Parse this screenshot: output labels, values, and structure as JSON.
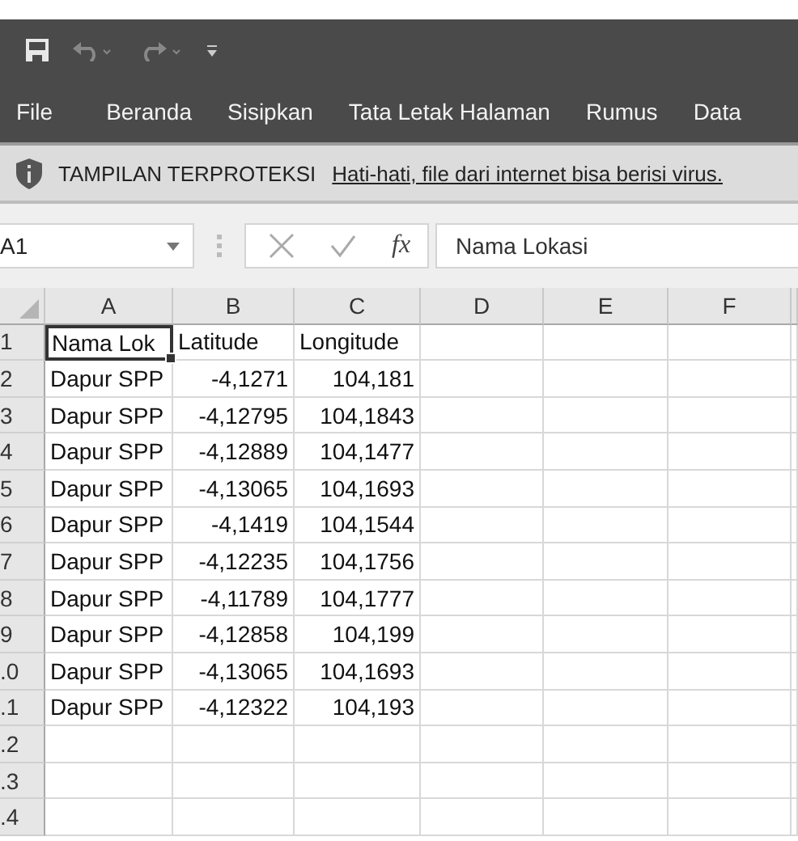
{
  "menu": [
    {
      "label": "File"
    },
    {
      "label": "Beranda"
    },
    {
      "label": "Sisipkan"
    },
    {
      "label": "Tata Letak Halaman"
    },
    {
      "label": "Rumus"
    },
    {
      "label": "Data"
    }
  ],
  "protected_view": {
    "label": "TAMPILAN TERPROTEKSI",
    "message": "Hati-hati, file dari internet bisa berisi virus."
  },
  "formula_bar": {
    "name_box": "A1",
    "function_label": "fx",
    "value": "Nama Lokasi"
  },
  "sheet": {
    "columns": [
      "A",
      "B",
      "C",
      "D",
      "E",
      "F"
    ],
    "rows": [
      {
        "header": "1",
        "cells": [
          {
            "text": "Nama Lok",
            "kind": "text",
            "selected": true
          },
          {
            "text": "Latitude",
            "kind": "text",
            "selected": false
          },
          {
            "text": "Longitude",
            "kind": "text",
            "selected": false
          }
        ]
      },
      {
        "header": "2",
        "cells": [
          {
            "text": "Dapur SPP",
            "kind": "text",
            "selected": false
          },
          {
            "text": "-4,1271",
            "kind": "number",
            "selected": false
          },
          {
            "text": "104,181",
            "kind": "number",
            "selected": false
          }
        ]
      },
      {
        "header": "3",
        "cells": [
          {
            "text": "Dapur SPP",
            "kind": "text",
            "selected": false
          },
          {
            "text": "-4,12795",
            "kind": "number",
            "selected": false
          },
          {
            "text": "104,1843",
            "kind": "number",
            "selected": false
          }
        ]
      },
      {
        "header": "4",
        "cells": [
          {
            "text": "Dapur SPP",
            "kind": "text",
            "selected": false
          },
          {
            "text": "-4,12889",
            "kind": "number",
            "selected": false
          },
          {
            "text": "104,1477",
            "kind": "number",
            "selected": false
          }
        ]
      },
      {
        "header": "5",
        "cells": [
          {
            "text": "Dapur SPP",
            "kind": "text",
            "selected": false
          },
          {
            "text": "-4,13065",
            "kind": "number",
            "selected": false
          },
          {
            "text": "104,1693",
            "kind": "number",
            "selected": false
          }
        ]
      },
      {
        "header": "6",
        "cells": [
          {
            "text": "Dapur SPP",
            "kind": "text",
            "selected": false
          },
          {
            "text": "-4,1419",
            "kind": "number",
            "selected": false
          },
          {
            "text": "104,1544",
            "kind": "number",
            "selected": false
          }
        ]
      },
      {
        "header": "7",
        "cells": [
          {
            "text": "Dapur SPP",
            "kind": "text",
            "selected": false
          },
          {
            "text": "-4,12235",
            "kind": "number",
            "selected": false
          },
          {
            "text": "104,1756",
            "kind": "number",
            "selected": false
          }
        ]
      },
      {
        "header": "8",
        "cells": [
          {
            "text": "Dapur SPP",
            "kind": "text",
            "selected": false
          },
          {
            "text": "-4,11789",
            "kind": "number",
            "selected": false
          },
          {
            "text": "104,1777",
            "kind": "number",
            "selected": false
          }
        ]
      },
      {
        "header": "9",
        "cells": [
          {
            "text": "Dapur SPP",
            "kind": "text",
            "selected": false
          },
          {
            "text": "-4,12858",
            "kind": "number",
            "selected": false
          },
          {
            "text": "104,199",
            "kind": "number",
            "selected": false
          }
        ]
      },
      {
        "header": ".0",
        "cells": [
          {
            "text": "Dapur SPP",
            "kind": "text",
            "selected": false
          },
          {
            "text": "-4,13065",
            "kind": "number",
            "selected": false
          },
          {
            "text": "104,1693",
            "kind": "number",
            "selected": false
          }
        ]
      },
      {
        "header": ".1",
        "cells": [
          {
            "text": "Dapur SPP",
            "kind": "text",
            "selected": false
          },
          {
            "text": "-4,12322",
            "kind": "number",
            "selected": false
          },
          {
            "text": "104,193",
            "kind": "number",
            "selected": false
          }
        ]
      },
      {
        "header": ".2"
      },
      {
        "header": ".3"
      },
      {
        "header": ".4"
      }
    ]
  }
}
